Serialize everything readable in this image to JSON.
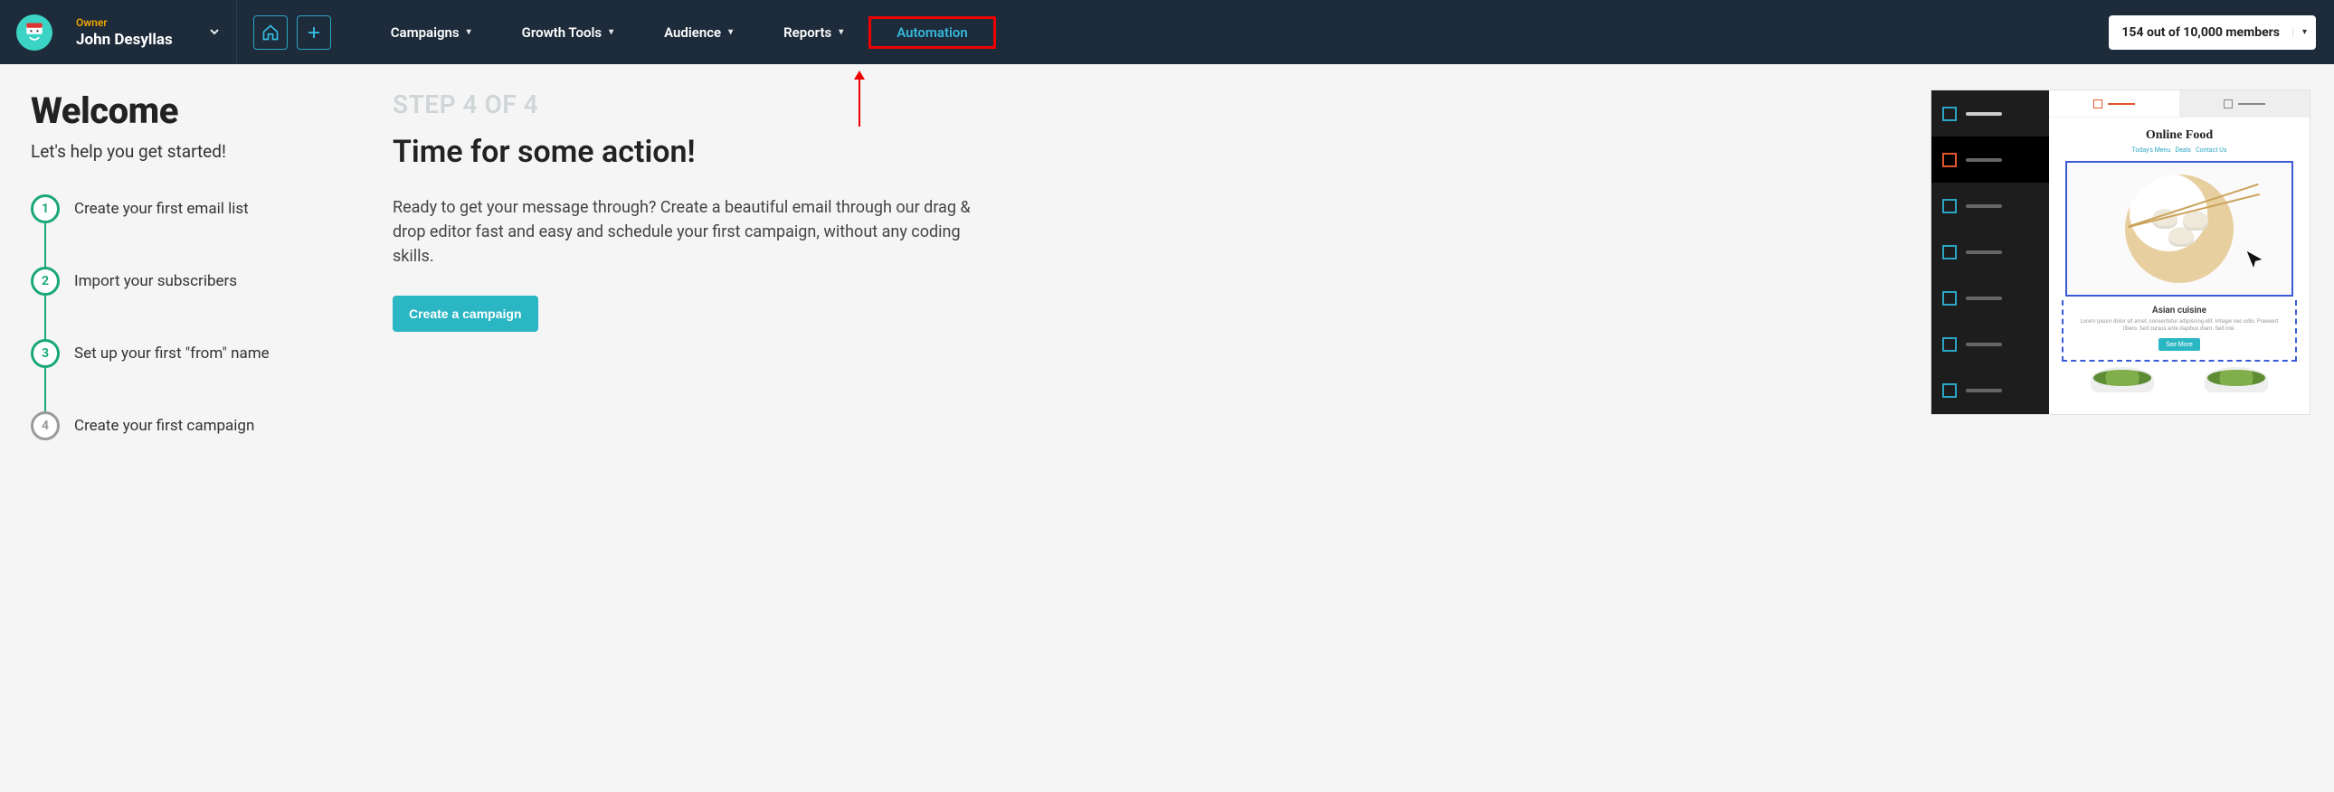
{
  "header": {
    "owner_label": "Owner",
    "owner_name": "John Desyllas",
    "nav": {
      "campaigns": "Campaigns",
      "growth": "Growth Tools",
      "audience": "Audience",
      "reports": "Reports",
      "automation": "Automation"
    },
    "members_text": "154 out of 10,000 members"
  },
  "welcome": {
    "title": "Welcome",
    "subtitle": "Let's help you get started!",
    "steps": [
      "Create your first email list",
      "Import your subscribers",
      "Set up your first \"from\" name",
      "Create your first campaign"
    ]
  },
  "main": {
    "step_of": "STEP 4 OF 4",
    "headline": "Time for some action!",
    "paragraph": "Ready to get your message through? Create a beautiful email through our drag & drop editor fast and easy and schedule your first campaign, without any coding skills.",
    "cta": "Create a campaign"
  },
  "preview": {
    "title": "Online Food",
    "nav_text": "Today's Menu   Deals   Contact Us",
    "caption": "Asian cuisine",
    "lorem": "Lorem ipsum dolor sit amet, consectetur adipiscing elit. Integer nec odio. Praesent libero. Sed cursus ante dapibus diam. Sed nisi.",
    "btn": "See More"
  }
}
